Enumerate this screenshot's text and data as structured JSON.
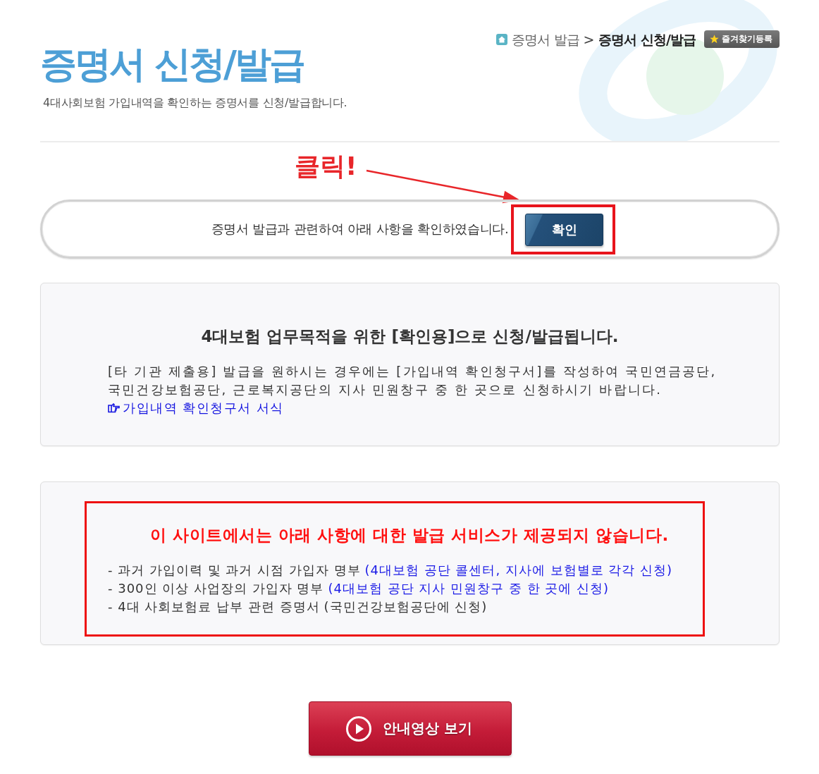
{
  "header": {
    "title": "증명서 신청/발급",
    "subtitle": "4대사회보험 가입내역을 확인하는 증명서를 신청/발급합니다."
  },
  "breadcrumb": [
    {
      "label": "증명서 발급",
      "current": false
    },
    {
      "label": "증명서 신청/발급",
      "current": true
    }
  ],
  "breadcrumb_separator": ">",
  "bookmark_button": {
    "label": "즐겨찾기등록"
  },
  "callout": {
    "label": "클릭!"
  },
  "confirm_bar": {
    "text": "증명서 발급과 관련하여 아래 사항을 확인하였습니다.",
    "button": {
      "label": "확인",
      "highlighted": true
    }
  },
  "info_box": {
    "heading": "4대보험 업무목적을 위한 [확인용]으로 신청/발급됩니다.",
    "body": "[타 기관 제출용] 발급을 원하시는 경우에는 [가입내역 확인청구서]를 작성하여 국민연금공단,\n국민건강보험공단, 근로복지공단의 지사 민원창구 중 한 곳으로 신청하시기 바랍니다.",
    "link": "가입내역 확인청구서 서식"
  },
  "notice_box": {
    "heading": "이 사이트에서는 아래 사항에 대한 발급 서비스가 제공되지 않습니다.",
    "highlighted": true,
    "items": [
      {
        "text": "- 과거 가입이력 및 과거 시점 가입자 명부",
        "note": "(4대보험 공단 콜센터, 지사에 보험별로 각각 신청)",
        "color": "#1a1ae6"
      },
      {
        "text": "- 300인 이상 사업장의 가입자 명부",
        "note": "(4대보험 공단 지사 민원창구 중 한 곳에 신청)",
        "color": "#1a1ae6"
      },
      {
        "text": "- 4대 사회보험료 납부 관련 증명서",
        "note": "(국민건강보험공단에 신청)",
        "color": "#333333"
      }
    ]
  },
  "video_button": {
    "label": "안내영상 보기"
  }
}
